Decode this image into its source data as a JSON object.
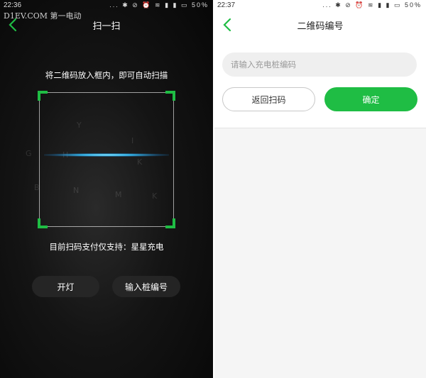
{
  "scan_screen": {
    "status_bar": {
      "time": "22:36",
      "icons": "... ✱ ⊘ ⏰ ≋ ▮ ▮ ▭ 50%"
    },
    "watermark": "D1EV.COM 第一电动",
    "title": "扫一扫",
    "hint": "将二维码放入框内，即可自动扫描",
    "support_text": "目前扫码支付仅支持：星星充电",
    "buttons": {
      "flashlight": "开灯",
      "enter_code": "输入桩编号"
    },
    "accent_color": "#1fbd44"
  },
  "code_screen": {
    "status_bar": {
      "time": "22:37",
      "icons": "... ✱ ⊘ ⏰ ≋ ▮ ▮ ▭ 50%"
    },
    "title": "二维码编号",
    "input": {
      "placeholder": "请输入充电桩编码",
      "value": ""
    },
    "buttons": {
      "back_to_scan": "返回扫码",
      "confirm": "确定"
    },
    "accent_color": "#1fbd44"
  }
}
